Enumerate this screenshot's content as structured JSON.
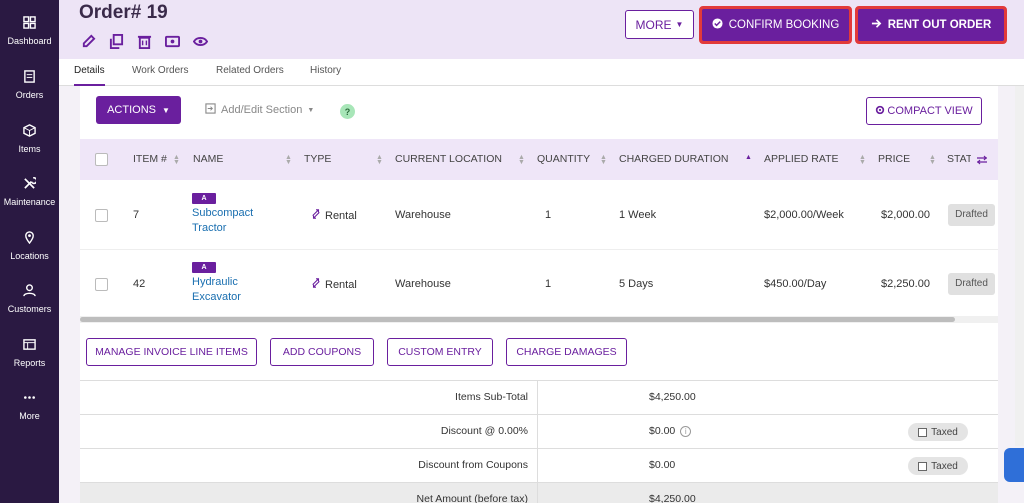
{
  "sidebar": {
    "items": [
      {
        "label": "Dashboard",
        "icon": "dashboard-icon"
      },
      {
        "label": "Orders",
        "icon": "orders-icon"
      },
      {
        "label": "Items",
        "icon": "items-icon"
      },
      {
        "label": "Maintenance",
        "icon": "maintenance-icon"
      },
      {
        "label": "Locations",
        "icon": "location-pin-icon"
      },
      {
        "label": "Customers",
        "icon": "user-icon"
      },
      {
        "label": "Reports",
        "icon": "reports-icon"
      },
      {
        "label": "More",
        "icon": "more-dots-icon"
      }
    ]
  },
  "header": {
    "title": "Order# 19",
    "more_label": "MORE",
    "confirm_label": "CONFIRM BOOKING",
    "rent_label": "RENT OUT ORDER"
  },
  "tabs": [
    "Details",
    "Work Orders",
    "Related Orders",
    "History"
  ],
  "toolbar": {
    "actions_label": "ACTIONS",
    "add_edit_label": "Add/Edit Section",
    "help_label": "?",
    "compact_label": "COMPACT VIEW"
  },
  "table": {
    "headers": [
      "ITEM #",
      "NAME",
      "TYPE",
      "CURRENT LOCATION",
      "QUANTITY",
      "CHARGED DURATION",
      "APPLIED RATE",
      "PRICE",
      "STAT"
    ],
    "rows": [
      {
        "item_no": "7",
        "badge": "A",
        "name_line1": "Subcompact",
        "name_line2": "Tractor",
        "type": "Rental",
        "location": "Warehouse",
        "quantity": "1",
        "duration": "1 Week",
        "rate": "$2,000.00/Week",
        "price": "$2,000.00",
        "status": "Drafted"
      },
      {
        "item_no": "42",
        "badge": "A",
        "name_line1": "Hydraulic",
        "name_line2": "Excavator",
        "type": "Rental",
        "location": "Warehouse",
        "quantity": "1",
        "duration": "5 Days",
        "rate": "$450.00/Day",
        "price": "$2,250.00",
        "status": "Drafted"
      }
    ]
  },
  "line_buttons": [
    "MANAGE INVOICE LINE ITEMS",
    "ADD COUPONS",
    "CUSTOM ENTRY",
    "CHARGE DAMAGES"
  ],
  "totals": [
    {
      "label": "Items Sub-Total",
      "value": "$4,250.00"
    },
    {
      "label": "Discount @  0.00%",
      "value": "$0.00",
      "taxed": "Taxed"
    },
    {
      "label": "Discount from Coupons",
      "value": "$0.00",
      "taxed": "Taxed"
    },
    {
      "label": "Net Amount (before tax)",
      "value": "$4,250.00"
    }
  ],
  "colors": {
    "sidebar": "#2a1942",
    "accent": "#6a1f9e",
    "highlight": "#e23a3a",
    "header_bg": "#ede4f6"
  }
}
